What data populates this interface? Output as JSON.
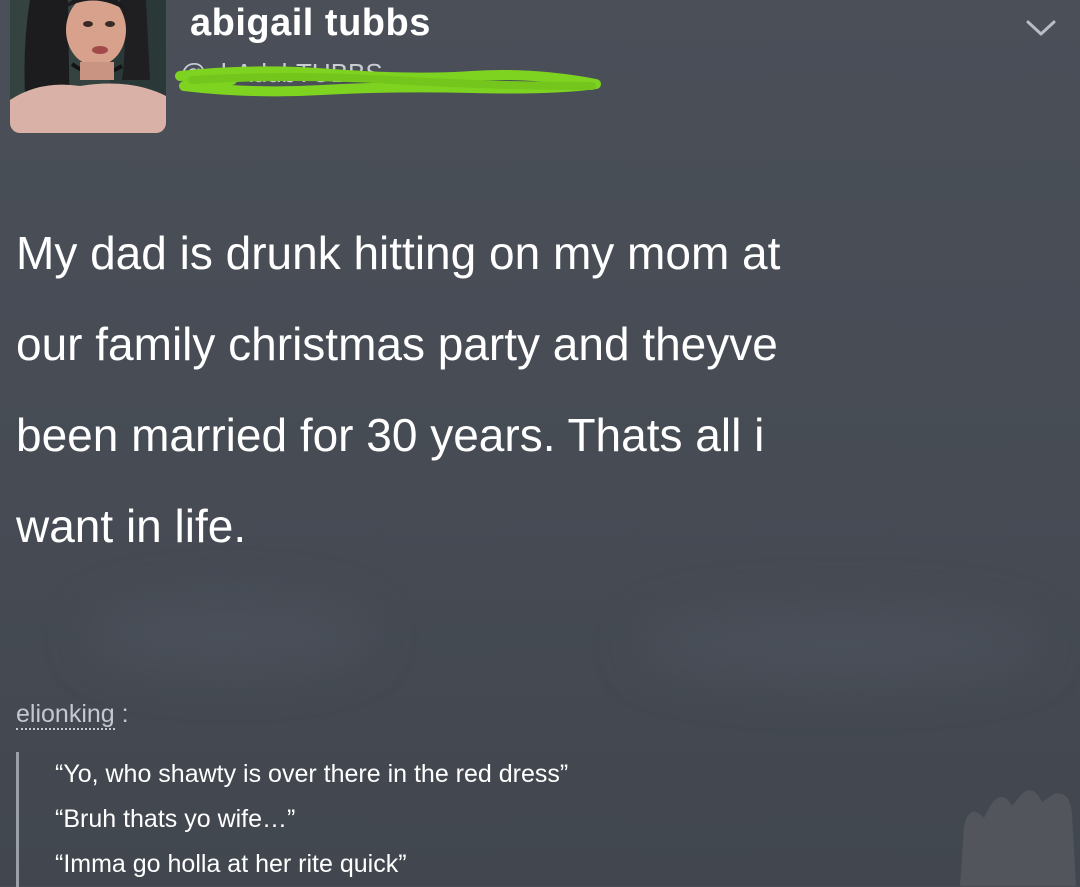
{
  "post": {
    "display_name": "abigail tubbs",
    "handle": "@ohAdubTUBBS",
    "body": "My dad is drunk hitting on my mom at\nour family christmas party and theyve\nbeen married for 30 years. Thats all i\nwant in life."
  },
  "reply": {
    "username": "elionking",
    "separator": " :",
    "lines": [
      "“Yo, who shawty is over there in the red dress”",
      "“Bruh thats yo wife…”",
      "“Imma go holla at her rite quick”"
    ]
  },
  "colors": {
    "background": "#474c55",
    "scribble": "#7ed321",
    "text": "#ffffff"
  },
  "icons": {
    "menu": "chevron-down-icon",
    "avatar": "profile-photo"
  }
}
